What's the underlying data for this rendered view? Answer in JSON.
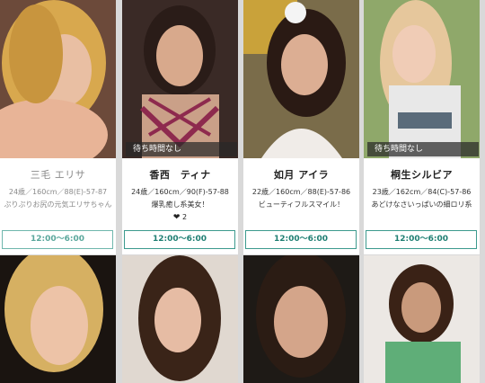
{
  "wait_label": "待ち時間なし",
  "cast": [
    {
      "name": "三毛 エリサ",
      "stats": "24歳／160cm／88(E)-57-87",
      "desc": "ぷりぷりお尻の元気エリサちゃん",
      "time": "12:00〜6:00",
      "waiting": false,
      "likes": ""
    },
    {
      "name": "香西　ティナ",
      "stats": "24歳／160cm／90(F)-57-88",
      "desc": "爆乳癒し系美女！",
      "time": "12:00〜6:00",
      "waiting": true,
      "likes": "2"
    },
    {
      "name": "如月 アイラ",
      "stats": "22歳／160cm／88(E)-57-86",
      "desc": "ビューティフルスマイル！",
      "time": "12:00〜6:00",
      "waiting": false,
      "likes": ""
    },
    {
      "name": "桐生シルビア",
      "stats": "23歳／162cm／84(C)-57-86",
      "desc": "あどけなさいっぱいの細ロリ系",
      "time": "12:00〜6:00",
      "waiting": true,
      "likes": ""
    }
  ]
}
